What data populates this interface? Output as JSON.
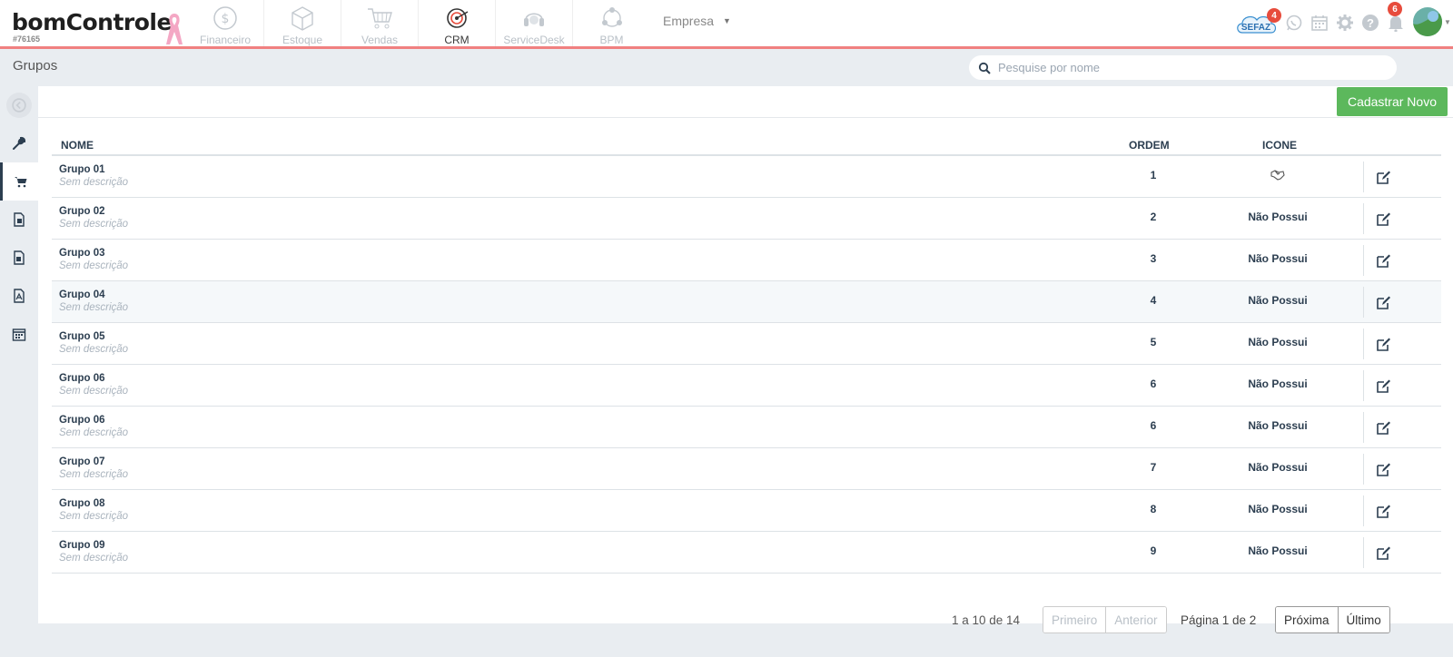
{
  "brand": {
    "name_prefix": "bom",
    "name_suffix": "Controle",
    "account_id": "#76165"
  },
  "modules": [
    {
      "label": "Financeiro",
      "icon": "dollar-coin-icon",
      "active": false
    },
    {
      "label": "Estoque",
      "icon": "box-icon",
      "active": false
    },
    {
      "label": "Vendas",
      "icon": "shopping-cart-icon",
      "active": false
    },
    {
      "label": "CRM",
      "icon": "target-icon",
      "active": true
    },
    {
      "label": "ServiceDesk",
      "icon": "headset-icon",
      "active": false
    },
    {
      "label": "BPM",
      "icon": "process-icon",
      "active": false
    }
  ],
  "company_selector": {
    "label": "Empresa"
  },
  "topbar_right": {
    "sefaz_label": "SEFAZ",
    "sefaz_badge": "4",
    "notifications_badge": "6",
    "colors": {
      "badge": "#e74c3c",
      "accent_border": "#f08080"
    }
  },
  "page": {
    "title": "Grupos"
  },
  "search": {
    "placeholder": "Pesquise por nome"
  },
  "toolbar": {
    "new_button_label": "Cadastrar Novo",
    "new_button_color": "#5cb85c"
  },
  "sidebar": {
    "items": [
      {
        "icon": "collapse-icon"
      },
      {
        "icon": "wrench-icon"
      },
      {
        "icon": "cart-icon",
        "active": true
      },
      {
        "icon": "document-icon"
      },
      {
        "icon": "document-icon"
      },
      {
        "icon": "pdf-file-icon"
      },
      {
        "icon": "calendar-icon"
      }
    ]
  },
  "table": {
    "columns": {
      "name": "NOME",
      "order": "ORDEM",
      "icon": "ICONE"
    },
    "rows": [
      {
        "name": "Grupo 01",
        "description": "Sem descrição",
        "order": "1",
        "icon": "",
        "has_icon": true
      },
      {
        "name": "Grupo 02",
        "description": "Sem descrição",
        "order": "2",
        "icon": "Não Possui"
      },
      {
        "name": "Grupo 03",
        "description": "Sem descrição",
        "order": "3",
        "icon": "Não Possui"
      },
      {
        "name": "Grupo 04",
        "description": "Sem descrição",
        "order": "4",
        "icon": "Não Possui",
        "hover": true
      },
      {
        "name": "Grupo 05",
        "description": "Sem descrição",
        "order": "5",
        "icon": "Não Possui"
      },
      {
        "name": "Grupo 06",
        "description": "Sem descrição",
        "order": "6",
        "icon": "Não Possui"
      },
      {
        "name": "Grupo 06",
        "description": "Sem descrição",
        "order": "6",
        "icon": "Não Possui"
      },
      {
        "name": "Grupo 07",
        "description": "Sem descrição",
        "order": "7",
        "icon": "Não Possui"
      },
      {
        "name": "Grupo 08",
        "description": "Sem descrição",
        "order": "8",
        "icon": "Não Possui"
      },
      {
        "name": "Grupo 09",
        "description": "Sem descrição",
        "order": "9",
        "icon": "Não Possui"
      }
    ]
  },
  "pagination": {
    "range_text": "1 a 10 de 14",
    "first_label": "Primeiro",
    "prev_label": "Anterior",
    "page_text": "Página 1 de 2",
    "next_label": "Próxima",
    "last_label": "Último"
  }
}
